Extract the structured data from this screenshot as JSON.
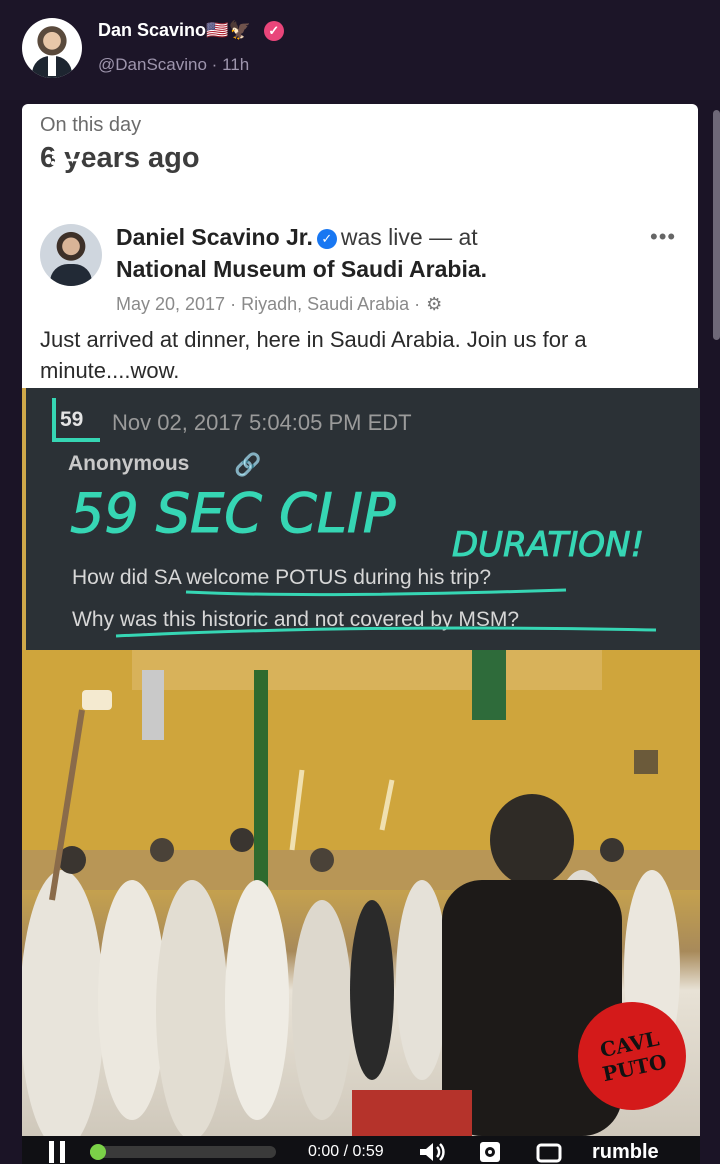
{
  "post": {
    "display_name": "Dan Scavino🇺🇸🦅",
    "handle": "@DanScavino",
    "time_ago": "11h",
    "separator": "·"
  },
  "memory": {
    "title": "On this day",
    "subtitle": "6 years ago",
    "author": "Daniel Scavino Jr.",
    "status": "was live — at",
    "location": "National Museum of Saudi Arabia.",
    "meta": "May 20, 2017 · Riyadh, Saudi Arabia ·",
    "text": "Just arrived at dinner, here in Saudi Arabia. Join us for a minute....wow."
  },
  "q_drop": {
    "number": "59",
    "date": "Nov 02, 2017 5:04:05 PM EDT",
    "author": "Anonymous",
    "annotation_line1": "59 SEC CLIP",
    "annotation_line2": "DURATION!",
    "line1": "How did SA welcome POTUS during his trip?",
    "line2": "Why was this historic and not covered by MSM?",
    "accent_color": "#36d6b4"
  },
  "player": {
    "time": "0:00 / 0:59",
    "progress": 0.0,
    "brand": "rumble",
    "channel_logo_text": "CAVL PUTO"
  },
  "colors": {
    "background": "#1b1426",
    "progress": "#7bd148",
    "badge": "#e9457a",
    "verified": "#1877f2"
  }
}
